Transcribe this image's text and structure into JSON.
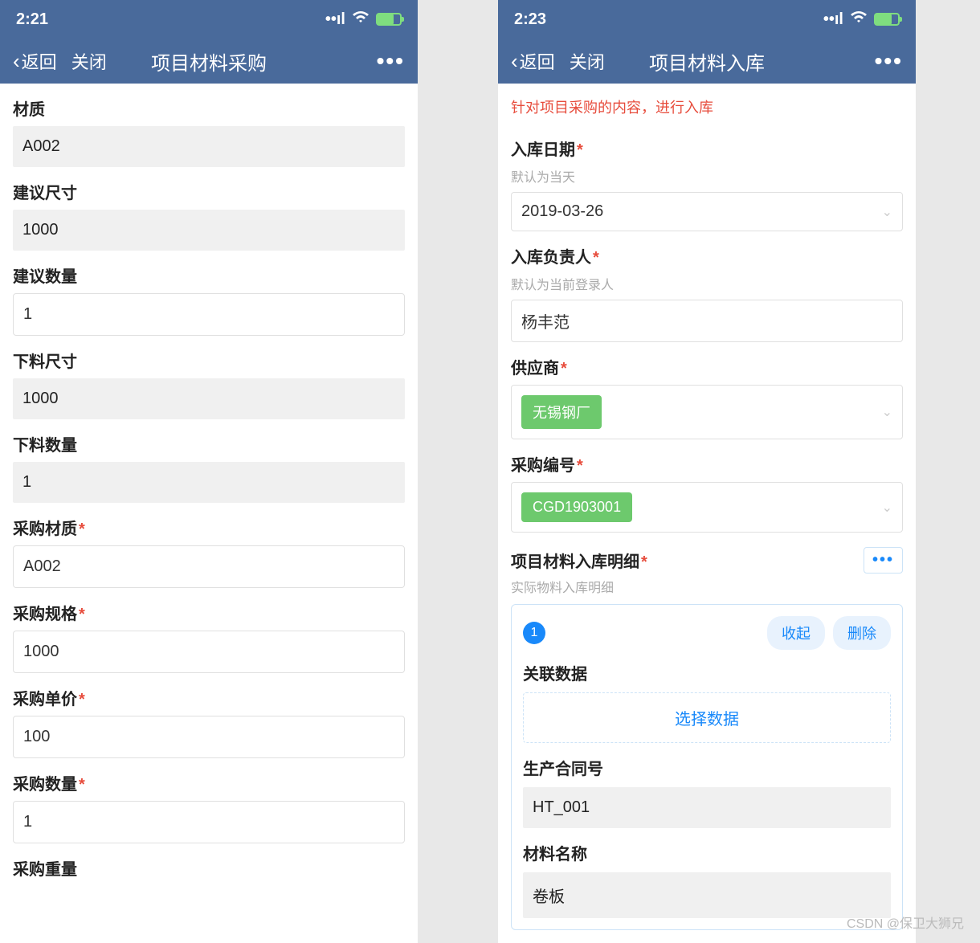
{
  "left": {
    "status": {
      "time": "2:21"
    },
    "nav": {
      "back": "返回",
      "close": "关闭",
      "title": "项目材料采购",
      "more": "•••"
    },
    "fields": {
      "material": {
        "label": "材质",
        "value": "A002"
      },
      "suggested_size": {
        "label": "建议尺寸",
        "value": "1000"
      },
      "suggested_qty": {
        "label": "建议数量",
        "value": "1"
      },
      "cut_size": {
        "label": "下料尺寸",
        "value": "1000"
      },
      "cut_qty": {
        "label": "下料数量",
        "value": "1"
      },
      "purchase_material": {
        "label": "采购材质",
        "value": "A002"
      },
      "purchase_spec": {
        "label": "采购规格",
        "value": "1000"
      },
      "purchase_price": {
        "label": "采购单价",
        "value": "100"
      },
      "purchase_qty": {
        "label": "采购数量",
        "value": "1"
      },
      "purchase_weight": {
        "label": "采购重量"
      }
    }
  },
  "right": {
    "status": {
      "time": "2:23"
    },
    "nav": {
      "back": "返回",
      "close": "关闭",
      "title": "项目材料入库",
      "more": "•••"
    },
    "notice": "针对项目采购的内容，进行入库",
    "fields": {
      "in_date": {
        "label": "入库日期",
        "hint": "默认为当天",
        "value": "2019-03-26"
      },
      "in_owner": {
        "label": "入库负责人",
        "hint": "默认为当前登录人",
        "value": "杨丰范"
      },
      "supplier": {
        "label": "供应商",
        "value": "无锡钢厂"
      },
      "purchase_no": {
        "label": "采购编号",
        "value": "CGD1903001"
      }
    },
    "detail": {
      "title": "项目材料入库明细",
      "hint": "实际物料入库明细",
      "more": "•••",
      "card": {
        "index": "1",
        "collapse": "收起",
        "delete": "删除",
        "link_label": "关联数据",
        "link_btn": "选择数据",
        "contract_label": "生产合同号",
        "contract_value": "HT_001",
        "material_label": "材料名称",
        "material_value": "卷板"
      }
    }
  },
  "watermark": "CSDN @保卫大狮兄"
}
